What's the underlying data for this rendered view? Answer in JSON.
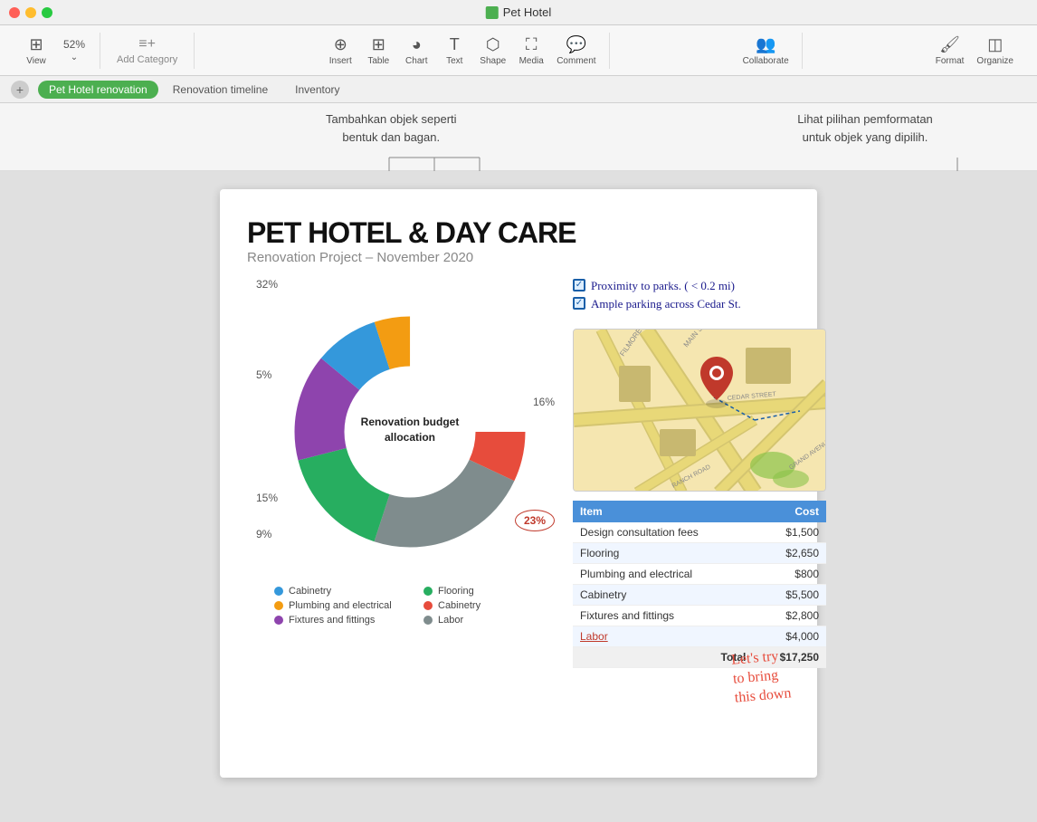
{
  "window": {
    "title": "Pet Hotel",
    "doc_icon_color": "#4caf50"
  },
  "toolbar": {
    "view_label": "View",
    "zoom_label": "52%",
    "zoom_icon": "⌄",
    "add_category_label": "Add Category",
    "insert_label": "Insert",
    "table_label": "Table",
    "chart_label": "Chart",
    "text_label": "Text",
    "shape_label": "Shape",
    "media_label": "Media",
    "comment_label": "Comment",
    "collaborate_label": "Collaborate",
    "format_label": "Format",
    "organize_label": "Organize"
  },
  "tabs": [
    {
      "label": "Pet Hotel renovation",
      "active": true
    },
    {
      "label": "Renovation timeline",
      "active": false
    },
    {
      "label": "Inventory",
      "active": false
    }
  ],
  "annotations": {
    "left_text": "Tambahkan objek seperti\nbentuk dan bagan.",
    "right_text": "Lihat pilihan pemformatan\nuntuk objek yang dipilih."
  },
  "document": {
    "title": "PET HOTEL & DAY CARE",
    "subtitle": "Renovation Project – November 2020",
    "chart": {
      "center_text": "Renovation budget allocation",
      "labels": {
        "top": "32%",
        "right": "16%",
        "left_mid": "5%",
        "left_low": "15%",
        "left_bottom": "9%",
        "bottom_right": "23%"
      },
      "segments": [
        {
          "label": "Cabinetry",
          "color": "#e74c3c",
          "percent": 32
        },
        {
          "label": "Labor",
          "color": "#7f8c8d",
          "percent": 23
        },
        {
          "label": "Flooring",
          "color": "#27ae60",
          "percent": 16
        },
        {
          "label": "Fixtures and fittings",
          "color": "#8e44ad",
          "percent": 15
        },
        {
          "label": "Design consultation fees",
          "color": "#3498db",
          "percent": 9
        },
        {
          "label": "Plumbing and electrical",
          "color": "#f39c12",
          "percent": 5
        }
      ]
    },
    "checklist": [
      "Proximity to parks. ( < 0.2 mi)",
      "Ample parking across  Cedar St."
    ],
    "table": {
      "headers": [
        "Item",
        "Cost"
      ],
      "rows": [
        [
          "Design consultation fees",
          "$1,500"
        ],
        [
          "Flooring",
          "$2,650"
        ],
        [
          "Plumbing and electrical",
          "$800"
        ],
        [
          "Cabinetry",
          "$5,500"
        ],
        [
          "Fixtures and fittings",
          "$2,800"
        ],
        [
          "Labor",
          "$4,000"
        ]
      ],
      "total_label": "Total",
      "total_value": "$17,250"
    },
    "handwritten_note": "Let's try\nto bring\nthis down"
  }
}
